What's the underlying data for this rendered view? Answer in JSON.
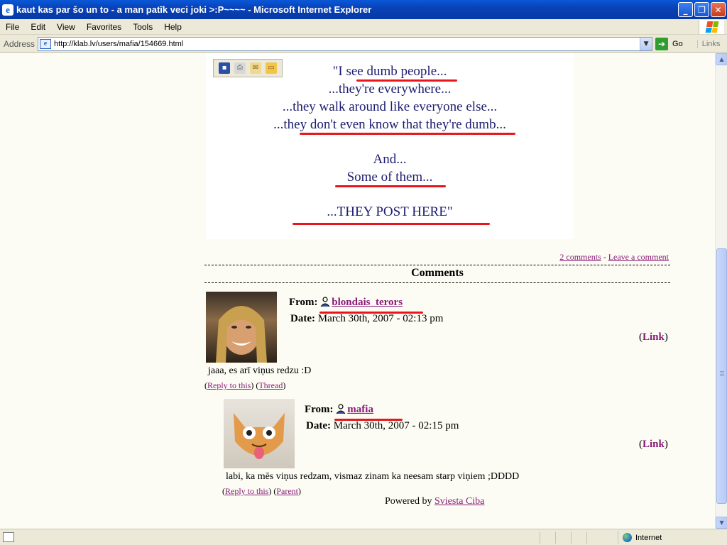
{
  "window": {
    "title": "kaut kas par šo un to - a man patīk veci joki >:P~~~~ - Microsoft Internet Explorer",
    "minimize": "_",
    "maximize": "❐",
    "close": "✕"
  },
  "menu": [
    "File",
    "Edit",
    "View",
    "Favorites",
    "Tools",
    "Help"
  ],
  "address": {
    "label": "Address",
    "url": "http://klab.lv/users/mafia/154669.html",
    "go_label": "Go",
    "links_label": "Links"
  },
  "post_image": {
    "lines": [
      "\"I see dumb people...",
      "...they're everywhere...",
      "...they walk around like everyone else...",
      "...they don't even know that they're dumb...",
      "And...",
      "Some of them...",
      "...THEY POST HERE\""
    ]
  },
  "post_links": {
    "comments": "2 comments",
    "separator": " - ",
    "leave": "Leave a comment"
  },
  "comments_heading": "Comments",
  "comments": [
    {
      "from_label": "From:",
      "username": "blondais_terors",
      "date_label": "Date:",
      "date": "March 30th, 2007 - 02:13 pm",
      "link_label": "Link",
      "text": "jaaa, es arī viņus redzu :D",
      "reply_label": "Reply to this",
      "second_label": "Thread"
    },
    {
      "from_label": "From:",
      "username": "mafia",
      "date_label": "Date:",
      "date": "March 30th, 2007 - 02:15 pm",
      "link_label": "Link",
      "text": "labi, ka mēs viņus redzam, vismaz zinam ka neesam starp viņiem ;DDDD",
      "reply_label": "Reply to this",
      "second_label": "Parent"
    }
  ],
  "footer": {
    "powered_label": "Powered by",
    "powered_link": "Sviesta Ciba"
  },
  "status": {
    "zone": "Internet"
  }
}
